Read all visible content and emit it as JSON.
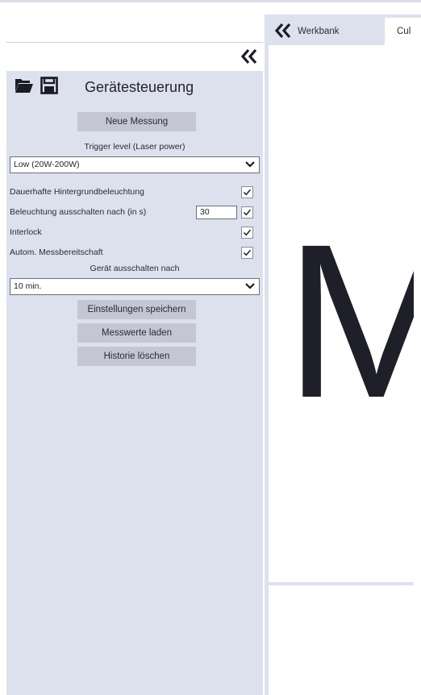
{
  "panel": {
    "title": "Gerätesteuerung",
    "new_measurement_label": "Neue Messung",
    "trigger_label": "Trigger level (Laser power)",
    "trigger_value": "Low (20W-200W)",
    "options": [
      {
        "label": "Dauerhafte Hintergrundbeleuchtung",
        "checked": true
      },
      {
        "label": "Beleuchtung ausschalten nach (in s)",
        "value": "30",
        "checked": true
      },
      {
        "label": "Interlock",
        "checked": true
      },
      {
        "label": "Autom. Messbereitschaft",
        "checked": true
      }
    ],
    "shutdown_label": "Gerät ausschalten nach",
    "shutdown_value": "10 min.",
    "save_settings_label": "Einstellungen speichern",
    "load_values_label": "Messwerte laden",
    "clear_history_label": "Historie löschen"
  },
  "tabs": [
    "Werkbank",
    "Cul"
  ],
  "content": {
    "big_letter": "M"
  },
  "icons": {
    "open": "folder-open-icon",
    "save": "save-icon",
    "collapse": "double-chevron-left-icon",
    "dropdown": "chevron-down-icon",
    "check": "checkmark-icon"
  }
}
